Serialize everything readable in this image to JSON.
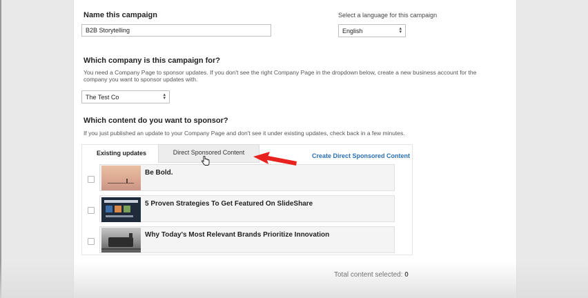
{
  "campaign": {
    "name_label": "Name this campaign",
    "name_value": "B2B Storytelling",
    "language_label": "Select a language for this campaign",
    "language_value": "English"
  },
  "company": {
    "heading": "Which company is this campaign for?",
    "help_line1": "You need a Company Page to sponsor updates. If you don't see the right Company Page in the dropdown below, create a new business account for the",
    "help_line2": "company you want to sponsor updates with.",
    "selected": "The Test Co"
  },
  "content": {
    "heading": "Which content do you want to sponsor?",
    "help": "If you just published an update to your Company Page and don't see it under existing updates, check back in a few minutes.",
    "tabs": [
      {
        "label": "Existing updates",
        "active": true
      },
      {
        "label": "Direct Sponsored Content",
        "active": false
      }
    ],
    "create_link": "Create Direct Sponsored Content",
    "updates": [
      {
        "title": "Be Bold.",
        "checked": false,
        "thumbnail": "sunset-pier-image"
      },
      {
        "title": "5 Proven Strategies To Get Featured On SlideShare",
        "checked": false,
        "thumbnail": "slideshare-screenshot-image"
      },
      {
        "title": "Why Today's Most Relevant Brands Prioritize Innovation",
        "checked": false,
        "thumbnail": "vintage-train-image"
      }
    ]
  },
  "footer": {
    "total_label": "Total content selected:",
    "total_value": "0"
  },
  "colors": {
    "link": "#2a6fb5",
    "annotation_arrow": "#e8231f"
  }
}
